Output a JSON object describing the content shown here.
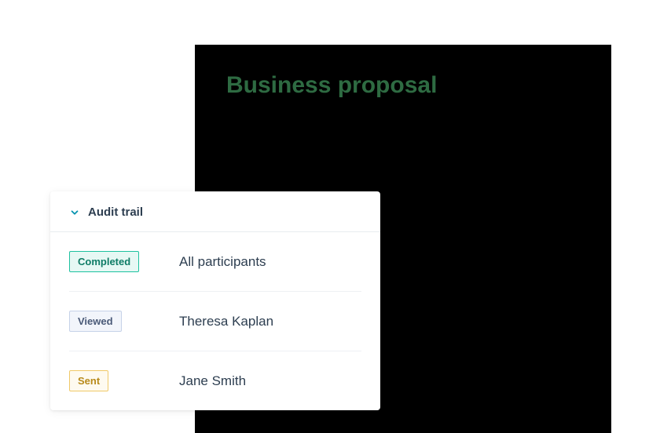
{
  "document": {
    "title": "Business proposal"
  },
  "audit": {
    "header_label": "Audit trail",
    "items": [
      {
        "status": "Completed",
        "status_class": "completed",
        "participant": "All participants"
      },
      {
        "status": "Viewed",
        "status_class": "viewed",
        "participant": "Theresa Kaplan"
      },
      {
        "status": "Sent",
        "status_class": "sent",
        "participant": "Jane Smith"
      }
    ]
  }
}
